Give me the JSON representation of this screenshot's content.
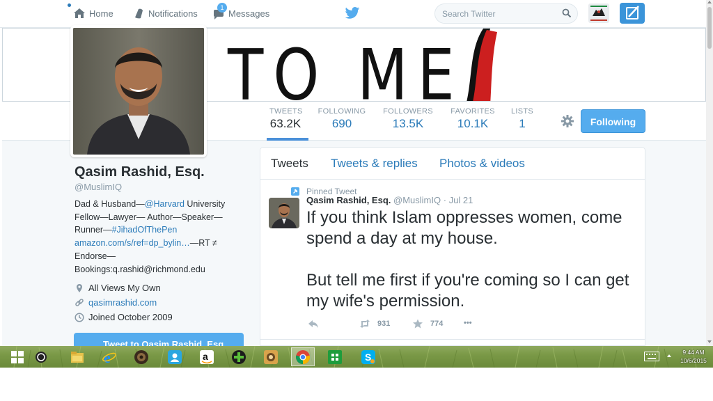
{
  "nav": {
    "home": "Home",
    "notifications": "Notifications",
    "messages": "Messages",
    "messages_badge": "1",
    "search_placeholder": "Search Twitter"
  },
  "banner": {
    "text": "TO ME"
  },
  "stats": [
    {
      "label": "TWEETS",
      "value": "63.2K"
    },
    {
      "label": "FOLLOWING",
      "value": "690"
    },
    {
      "label": "FOLLOWERS",
      "value": "13.5K"
    },
    {
      "label": "FAVORITES",
      "value": "10.1K"
    },
    {
      "label": "LISTS",
      "value": "1"
    }
  ],
  "follow_button": "Following",
  "profile": {
    "name": "Qasim Rashid, Esq.",
    "handle": "@MuslimIQ",
    "bio": {
      "t1": "Dad & Husband—",
      "l1": "@Harvard",
      "t2": " University Fellow—Lawyer— Author—Speaker—Runner—",
      "l2": "#JihadOfThePen",
      "l3": "amazon.com/s/ref=dp_bylin…",
      "t3": "—RT ≠ Endorse— Bookings:q.rashid@richmond.edu"
    },
    "location": "All Views My Own",
    "url": "qasimrashid.com",
    "joined": "Joined October 2009",
    "tweet_to": "Tweet to Qasim Rashid, Esq."
  },
  "tabs": [
    "Tweets",
    "Tweets & replies",
    "Photos & videos"
  ],
  "tweet": {
    "pinned_label": "Pinned Tweet",
    "name": "Qasim Rashid, Esq.",
    "handle": "@MuslimIQ",
    "separator": "·",
    "date": "Jul 21",
    "text_p1": "If you think Islam oppresses women, come spend a day at my house.",
    "text_p2": "But tell me first if you're coming so I can get my wife's permission.",
    "retweets": "931",
    "favorites": "774",
    "more": "•••"
  },
  "taskbar": {
    "time": "9:44 AM",
    "date": "10/6/2015",
    "apps": [
      "start",
      "cortana",
      "file-explorer",
      "internet-explorer",
      "media-player",
      "skype-meet",
      "amazon",
      "plus-app",
      "photo-app",
      "chrome",
      "office",
      "skype"
    ]
  },
  "colors": {
    "accent": "#55acee",
    "link": "#2b7bb9",
    "text": "#292f33",
    "muted": "#8899a6"
  }
}
